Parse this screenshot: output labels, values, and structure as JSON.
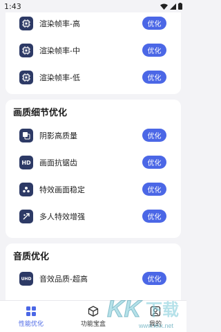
{
  "status": {
    "time": "1:43"
  },
  "section_render": {
    "rows": [
      {
        "label": "渲染帧率-高",
        "button": "优化",
        "icon": "chip-icon"
      },
      {
        "label": "渲染帧率-中",
        "button": "优化",
        "icon": "chip-icon"
      },
      {
        "label": "渲染帧率-低",
        "button": "优化",
        "icon": "chip-icon"
      }
    ]
  },
  "section_detail": {
    "title": "画质细节优化",
    "rows": [
      {
        "label": "阴影高质量",
        "button": "优化",
        "icon": "shadow-icon"
      },
      {
        "label": "画面抗锯齿",
        "button": "优化",
        "icon": "hd-icon",
        "icon_text": "HD"
      },
      {
        "label": "特效画面稳定",
        "button": "优化",
        "icon": "sparkle-icon"
      },
      {
        "label": "多人特效增强",
        "button": "优化",
        "icon": "effects-icon"
      }
    ]
  },
  "section_audio": {
    "title": "音质优化",
    "rows": [
      {
        "label": "音效品质-超高",
        "button": "优化",
        "icon": "uhd-icon",
        "icon_text": "UHD"
      }
    ]
  },
  "nav": {
    "items": [
      {
        "label": "性能优化",
        "icon": "grid-icon"
      },
      {
        "label": "功能宝盒",
        "icon": "box-icon"
      },
      {
        "label": "我的",
        "icon": "user-icon"
      }
    ]
  },
  "watermark": {
    "text": "KK下载",
    "url": "www.kkx.net"
  },
  "colors": {
    "accent": "#4b67e6",
    "icon_bg": "#2d3a66"
  }
}
